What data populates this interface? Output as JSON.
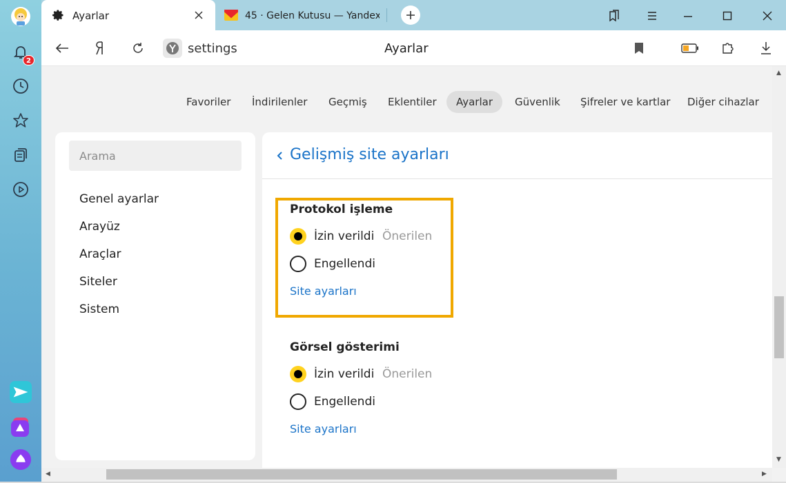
{
  "rail": {
    "notification_count": "2"
  },
  "tabs": {
    "active": {
      "title": "Ayarlar"
    },
    "inactive": {
      "title": "45 · Gelen Kutusu — Yandex"
    }
  },
  "address_bar": {
    "url_text": "settings",
    "page_title": "Ayarlar"
  },
  "nav": {
    "items": [
      "Favoriler",
      "İndirilenler",
      "Geçmiş",
      "Eklentiler",
      "Ayarlar",
      "Güvenlik",
      "Şifreler ve kartlar",
      "Diğer cihazlar"
    ],
    "active_index": 4
  },
  "sidebar": {
    "search_placeholder": "Arama",
    "items": [
      "Genel ayarlar",
      "Arayüz",
      "Araçlar",
      "Siteler",
      "Sistem"
    ]
  },
  "main": {
    "section_title": "Gelişmiş site ayarları",
    "groups": [
      {
        "title": "Protokol işleme",
        "option_allowed": "İzin verildi",
        "recommended": "Önerilen",
        "option_blocked": "Engellendi",
        "selected": "allowed",
        "link": "Site ayarları"
      },
      {
        "title": "Görsel gösterimi",
        "option_allowed": "İzin verildi",
        "recommended": "Önerilen",
        "option_blocked": "Engellendi",
        "selected": "allowed",
        "link": "Site ayarları"
      }
    ]
  },
  "colors": {
    "accent_link": "#1a73c8",
    "highlight_border": "#f0a800",
    "radio_checked": "#ffd21f"
  }
}
